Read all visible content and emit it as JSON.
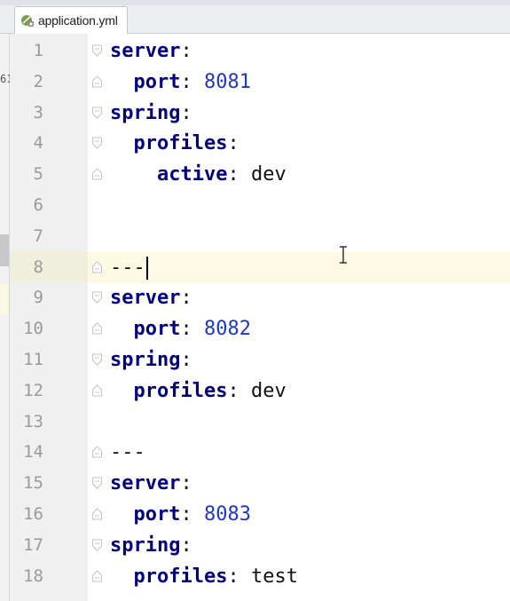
{
  "tab": {
    "label": "application.yml",
    "icon": "yaml-leaf-icon"
  },
  "side_glyph": "61",
  "lines": [
    {
      "n": "1",
      "indent": "",
      "key": "server",
      "sep": ":",
      "value": "",
      "value_type": "none"
    },
    {
      "n": "2",
      "indent": "  ",
      "key": "port",
      "sep": ": ",
      "value": "8081",
      "value_type": "num"
    },
    {
      "n": "3",
      "indent": "",
      "key": "spring",
      "sep": ":",
      "value": "",
      "value_type": "none"
    },
    {
      "n": "4",
      "indent": "  ",
      "key": "profiles",
      "sep": ":",
      "value": "",
      "value_type": "none"
    },
    {
      "n": "5",
      "indent": "    ",
      "key": "active",
      "sep": ": ",
      "value": "dev",
      "value_type": "str"
    },
    {
      "n": "6",
      "indent": "",
      "key": "",
      "sep": "",
      "value": "",
      "value_type": "none"
    },
    {
      "n": "7",
      "indent": "",
      "key": "",
      "sep": "",
      "value": "",
      "value_type": "none"
    },
    {
      "n": "8",
      "indent": "",
      "key": "",
      "sep": "---",
      "value": "",
      "value_type": "none",
      "current": true
    },
    {
      "n": "9",
      "indent": "",
      "key": "server",
      "sep": ":",
      "value": "",
      "value_type": "none"
    },
    {
      "n": "10",
      "indent": "  ",
      "key": "port",
      "sep": ": ",
      "value": "8082",
      "value_type": "num"
    },
    {
      "n": "11",
      "indent": "",
      "key": "spring",
      "sep": ":",
      "value": "",
      "value_type": "none"
    },
    {
      "n": "12",
      "indent": "  ",
      "key": "profiles",
      "sep": ": ",
      "value": "dev",
      "value_type": "str"
    },
    {
      "n": "13",
      "indent": "",
      "key": "",
      "sep": "",
      "value": "",
      "value_type": "none"
    },
    {
      "n": "14",
      "indent": "",
      "key": "",
      "sep": "---",
      "value": "",
      "value_type": "none"
    },
    {
      "n": "15",
      "indent": "",
      "key": "server",
      "sep": ":",
      "value": "",
      "value_type": "none"
    },
    {
      "n": "16",
      "indent": "  ",
      "key": "port",
      "sep": ": ",
      "value": "8083",
      "value_type": "num"
    },
    {
      "n": "17",
      "indent": "",
      "key": "spring",
      "sep": ":",
      "value": "",
      "value_type": "none"
    },
    {
      "n": "18",
      "indent": "  ",
      "key": "profiles",
      "sep": ": ",
      "value": "test",
      "value_type": "str"
    }
  ],
  "colors": {
    "key": "#000080",
    "number": "#1f37c8",
    "current_line": "#fcfae3",
    "gutter": "#f0f0f0",
    "line_number": "#9a9a9a"
  }
}
